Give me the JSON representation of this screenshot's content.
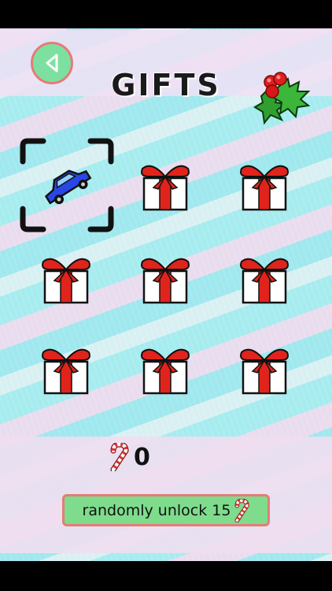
{
  "header": {
    "title": "GIFTS",
    "back_icon": "back-triangle-icon",
    "decoration_icon": "holly-icon"
  },
  "grid": {
    "tiles": [
      {
        "kind": "car",
        "selected": true,
        "icon": "blue-car-icon"
      },
      {
        "kind": "gift",
        "selected": false,
        "icon": "gift-box-icon"
      },
      {
        "kind": "gift",
        "selected": false,
        "icon": "gift-box-icon"
      },
      {
        "kind": "gift",
        "selected": false,
        "icon": "gift-box-icon"
      },
      {
        "kind": "gift",
        "selected": false,
        "icon": "gift-box-icon"
      },
      {
        "kind": "gift",
        "selected": false,
        "icon": "gift-box-icon"
      },
      {
        "kind": "gift",
        "selected": false,
        "icon": "gift-box-icon"
      },
      {
        "kind": "gift",
        "selected": false,
        "icon": "gift-box-icon"
      },
      {
        "kind": "gift",
        "selected": false,
        "icon": "gift-box-icon"
      }
    ]
  },
  "wallet": {
    "candy_count": "0",
    "icon": "candy-cane-icon"
  },
  "unlock": {
    "label": "randomly unlock 15",
    "icon": "candy-cane-icon"
  },
  "colors": {
    "button_green": "#7ee0a0",
    "button_border": "#e47c78",
    "gift_red": "#e0241c",
    "car_blue": "#1f3fe0"
  }
}
